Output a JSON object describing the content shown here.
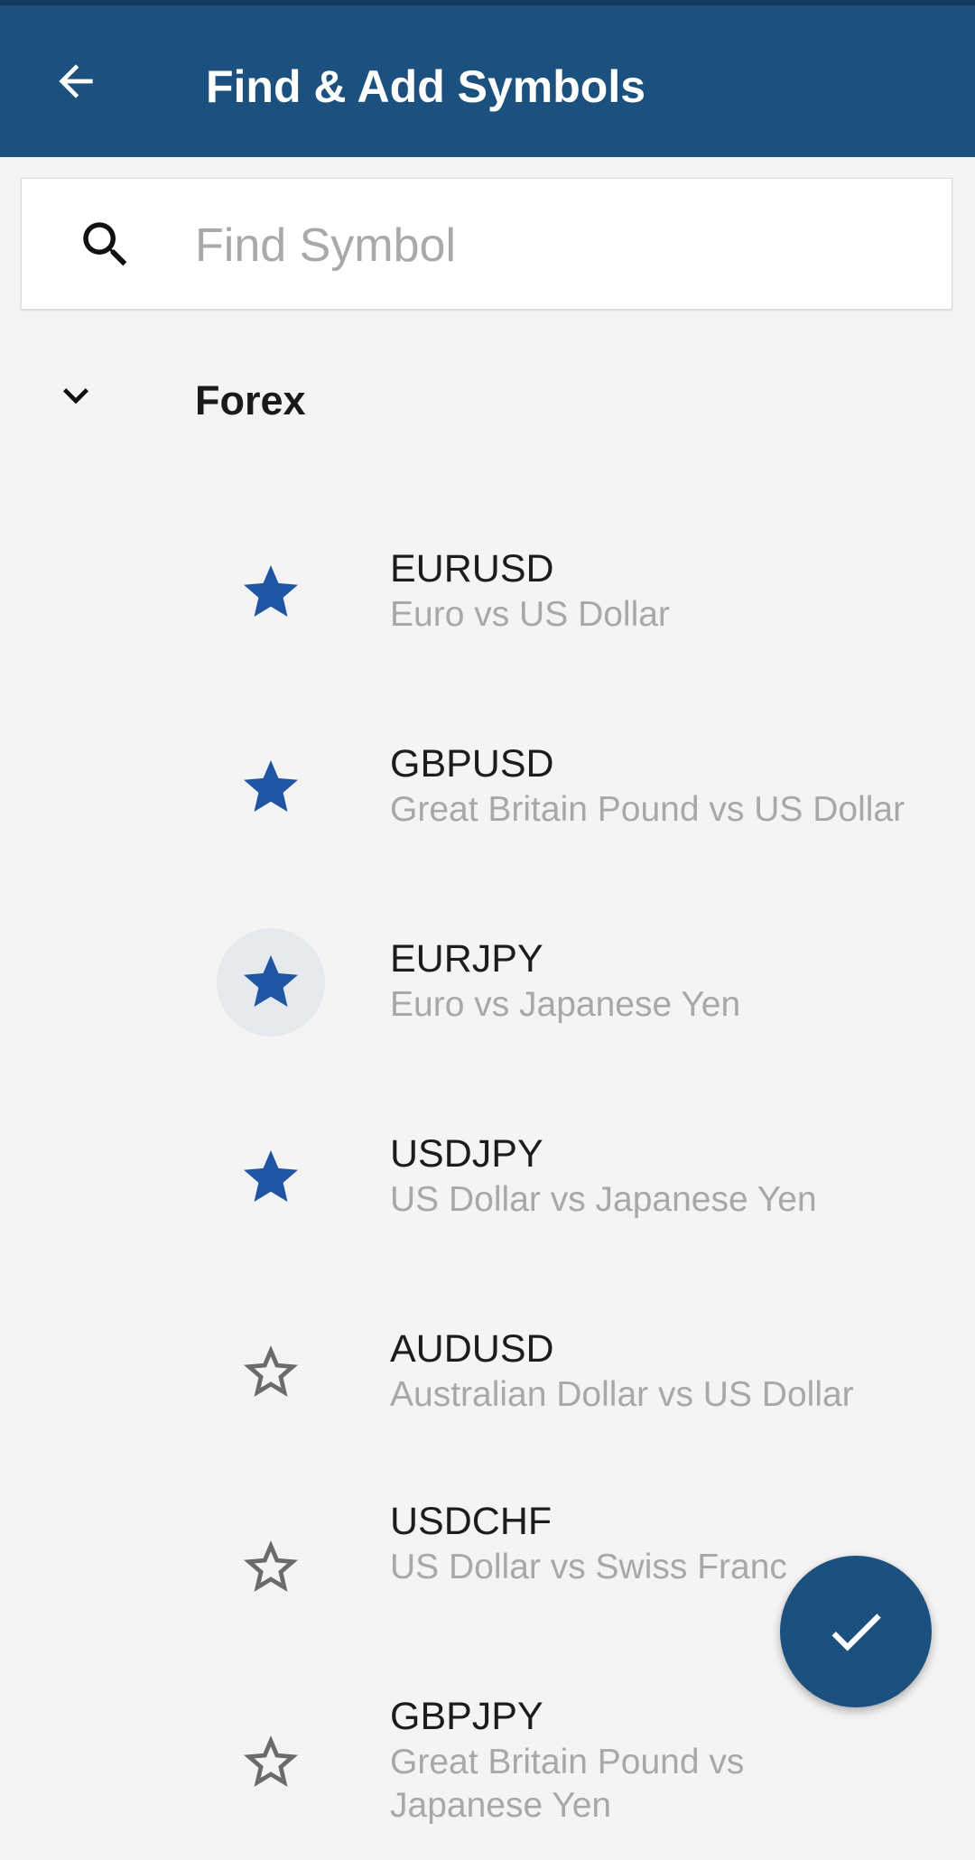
{
  "header": {
    "title": "Find & Add Symbols"
  },
  "search": {
    "placeholder": "Find Symbol",
    "value": ""
  },
  "group": {
    "label": "Forex",
    "expanded": true
  },
  "symbols": [
    {
      "symbol": "EURUSD",
      "description": "Euro vs US Dollar",
      "favorite": true
    },
    {
      "symbol": "GBPUSD",
      "description": "Great Britain Pound vs US Dollar",
      "favorite": true
    },
    {
      "symbol": "EURJPY",
      "description": "Euro vs Japanese Yen",
      "favorite": true
    },
    {
      "symbol": "USDJPY",
      "description": "US Dollar vs Japanese Yen",
      "favorite": true
    },
    {
      "symbol": "AUDUSD",
      "description": "Australian Dollar vs US Dollar",
      "favorite": false
    },
    {
      "symbol": "USDCHF",
      "description": "US Dollar vs Swiss Franc",
      "favorite": false
    },
    {
      "symbol": "GBPJPY",
      "description": "Great Britain Pound vs Japanese Yen",
      "favorite": false
    }
  ],
  "icons": {
    "back": "arrow-left-icon",
    "search": "search-icon",
    "group_toggle": "chevron-down-icon",
    "favorite_on": "star-filled-icon",
    "favorite_off": "star-outline-icon",
    "confirm": "check-icon"
  },
  "colors": {
    "app_bar": "#1c507f",
    "star_active": "#1f55a3",
    "star_inactive": "#6b6b6b",
    "background": "#f4f4f4"
  }
}
